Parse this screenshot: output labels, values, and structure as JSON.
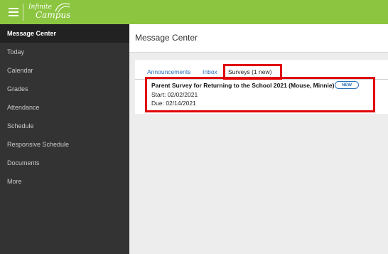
{
  "app": {
    "logo_line1": "Infinite",
    "logo_line2": "Campus",
    "brand_color": "#8cc540",
    "menu_icon": "hamburger-icon"
  },
  "sidebar": {
    "items": [
      {
        "label": "Message Center",
        "active": true
      },
      {
        "label": "Today"
      },
      {
        "label": "Calendar"
      },
      {
        "label": "Grades"
      },
      {
        "label": "Attendance"
      },
      {
        "label": "Schedule"
      },
      {
        "label": "Responsive Schedule"
      },
      {
        "label": "Documents"
      },
      {
        "label": "More"
      }
    ]
  },
  "main": {
    "title": "Message Center",
    "tabs": [
      {
        "label": "Announcements"
      },
      {
        "label": "Inbox"
      },
      {
        "label": "Surveys (1 new)",
        "selected": true
      }
    ],
    "survey": {
      "title": "Parent Survey for Returning to the School 2021 (Mouse, Minnie)",
      "badge": "NEW",
      "start": "Start: 02/02/2021",
      "due": "Due: 02/14/2021"
    },
    "highlight_color": "#e00000",
    "link_color": "#2a70b8"
  }
}
